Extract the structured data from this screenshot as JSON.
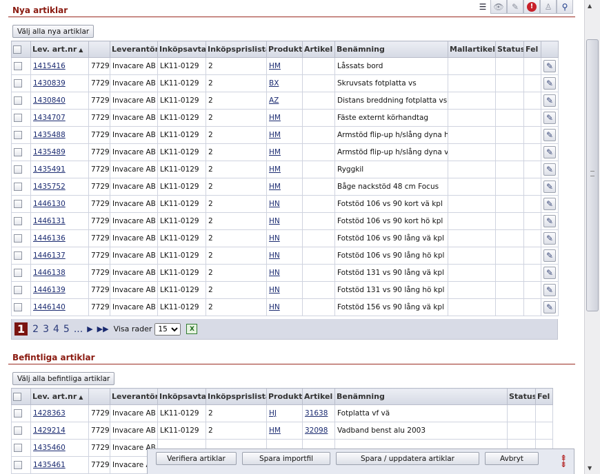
{
  "toolbar": {
    "icons": [
      "list-icon",
      "eye-icon",
      "pencil-icon",
      "warning-icon",
      "user-icon",
      "user-search-icon"
    ]
  },
  "new_section": {
    "title": "Nya artiklar",
    "select_all_label": "Välj alla nya artiklar",
    "columns": [
      "Lev. art.nr",
      "",
      "Leverantör",
      "Inköpsavtal",
      "Inköpsprislista",
      "Produkt",
      "Artikel",
      "Benämning",
      "Mallartikel",
      "Status",
      "Fel"
    ],
    "rows": [
      {
        "nr": "1415416",
        "code": "7729",
        "supplier": "Invacare AB",
        "agreement": "LK11-0129",
        "pricelist": "2",
        "product": "HM",
        "article": "",
        "name": "Låssats bord"
      },
      {
        "nr": "1430839",
        "code": "7729",
        "supplier": "Invacare AB",
        "agreement": "LK11-0129",
        "pricelist": "2",
        "product": "BX",
        "article": "",
        "name": "Skruvsats fotplatta vs"
      },
      {
        "nr": "1430840",
        "code": "7729",
        "supplier": "Invacare AB",
        "agreement": "LK11-0129",
        "pricelist": "2",
        "product": "AZ",
        "article": "",
        "name": "Distans breddning fotplatta vs"
      },
      {
        "nr": "1434707",
        "code": "7729",
        "supplier": "Invacare AB",
        "agreement": "LK11-0129",
        "pricelist": "2",
        "product": "HM",
        "article": "",
        "name": "Fäste externt körhandtag"
      },
      {
        "nr": "1435488",
        "code": "7729",
        "supplier": "Invacare AB",
        "agreement": "LK11-0129",
        "pricelist": "2",
        "product": "HM",
        "article": "",
        "name": "Armstöd flip-up h/slång dyna hö"
      },
      {
        "nr": "1435489",
        "code": "7729",
        "supplier": "Invacare AB",
        "agreement": "LK11-0129",
        "pricelist": "2",
        "product": "HM",
        "article": "",
        "name": "Armstöd flip-up h/slång dyna vä"
      },
      {
        "nr": "1435491",
        "code": "7729",
        "supplier": "Invacare AB",
        "agreement": "LK11-0129",
        "pricelist": "2",
        "product": "HM",
        "article": "",
        "name": "Ryggkil"
      },
      {
        "nr": "1435752",
        "code": "7729",
        "supplier": "Invacare AB",
        "agreement": "LK11-0129",
        "pricelist": "2",
        "product": "HM",
        "article": "",
        "name": "Båge nackstöd 48 cm Focus"
      },
      {
        "nr": "1446130",
        "code": "7729",
        "supplier": "Invacare AB",
        "agreement": "LK11-0129",
        "pricelist": "2",
        "product": "HN",
        "article": "",
        "name": "Fotstöd 106 vs 90 kort vä kpl"
      },
      {
        "nr": "1446131",
        "code": "7729",
        "supplier": "Invacare AB",
        "agreement": "LK11-0129",
        "pricelist": "2",
        "product": "HN",
        "article": "",
        "name": "Fotstöd 106 vs 90 kort hö kpl"
      },
      {
        "nr": "1446136",
        "code": "7729",
        "supplier": "Invacare AB",
        "agreement": "LK11-0129",
        "pricelist": "2",
        "product": "HN",
        "article": "",
        "name": "Fotstöd 106 vs 90 lång vä kpl"
      },
      {
        "nr": "1446137",
        "code": "7729",
        "supplier": "Invacare AB",
        "agreement": "LK11-0129",
        "pricelist": "2",
        "product": "HN",
        "article": "",
        "name": "Fotstöd 106 vs 90 lång hö kpl"
      },
      {
        "nr": "1446138",
        "code": "7729",
        "supplier": "Invacare AB",
        "agreement": "LK11-0129",
        "pricelist": "2",
        "product": "HN",
        "article": "",
        "name": "Fotstöd 131 vs 90 lång vä kpl"
      },
      {
        "nr": "1446139",
        "code": "7729",
        "supplier": "Invacare AB",
        "agreement": "LK11-0129",
        "pricelist": "2",
        "product": "HN",
        "article": "",
        "name": "Fotstöd 131 vs 90 lång hö kpl"
      },
      {
        "nr": "1446140",
        "code": "7729",
        "supplier": "Invacare AB",
        "agreement": "LK11-0129",
        "pricelist": "2",
        "product": "HN",
        "article": "",
        "name": "Fotstöd 156 vs 90 lång vä kpl"
      }
    ],
    "pager": {
      "current": "1",
      "pages": [
        "2",
        "3",
        "4",
        "5"
      ],
      "ellipsis": "...",
      "rows_label": "Visa rader",
      "rows_value": "15"
    }
  },
  "existing_section": {
    "title": "Befintliga artiklar",
    "select_all_label": "Välj alla befintliga artiklar",
    "columns": [
      "Lev. art.nr",
      "",
      "Leverantör",
      "Inköpsavtal",
      "Inköpsprislista",
      "Produkt",
      "Artikel",
      "Benämning",
      "Status",
      "Fel"
    ],
    "rows": [
      {
        "nr": "1428363",
        "code": "7729",
        "supplier": "Invacare AB",
        "agreement": "LK11-0129",
        "pricelist": "2",
        "product": "HJ",
        "article": "31638",
        "name": "Fotplatta vf vä"
      },
      {
        "nr": "1429214",
        "code": "7729",
        "supplier": "Invacare AB",
        "agreement": "LK11-0129",
        "pricelist": "2",
        "product": "HM",
        "article": "32098",
        "name": "Vadband benst alu 2003"
      },
      {
        "nr": "1435460",
        "code": "7729",
        "supplier": "Invacare AB",
        "agreement": "",
        "pricelist": "",
        "product": "",
        "article": "",
        "name": ""
      },
      {
        "nr": "1435461",
        "code": "7729",
        "supplier": "Invacare A",
        "agreement": "",
        "pricelist": "",
        "product": "",
        "article": "",
        "name": ""
      }
    ]
  },
  "actions": {
    "verify": "Verifiera artiklar",
    "save_import": "Spara importfil",
    "save_update": "Spara / uppdatera artiklar",
    "cancel": "Avbryt"
  },
  "colors": {
    "section_title": "#8a1a10",
    "link": "#1a2a70",
    "pager_current": "#7a1410",
    "warning": "#c8202a"
  }
}
